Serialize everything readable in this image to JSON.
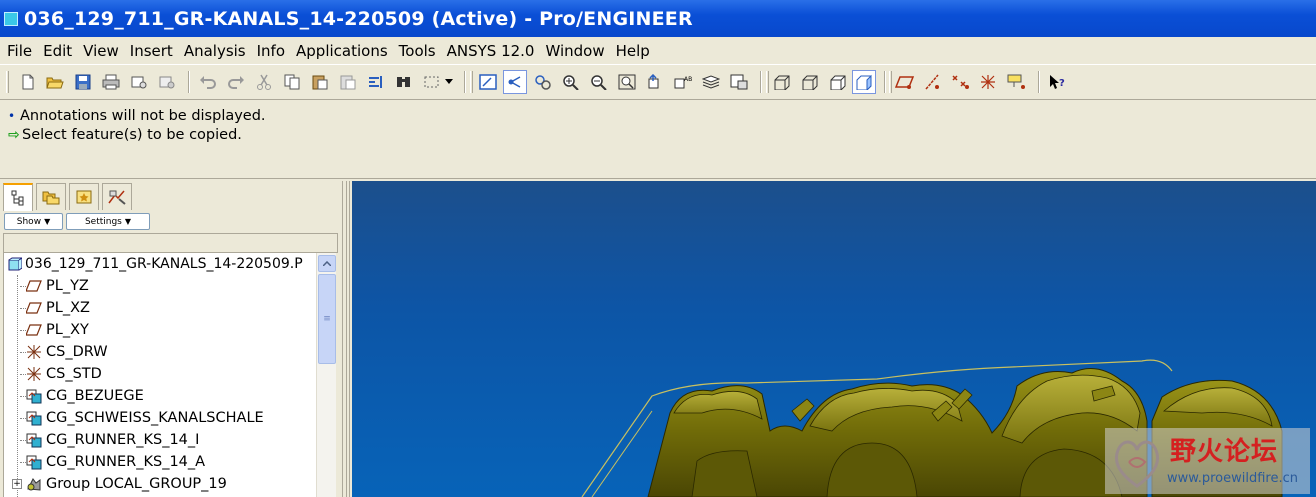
{
  "window": {
    "title": "036_129_711_GR-KANALS_14-220509 (Active) - Pro/ENGINEER"
  },
  "menu": {
    "items": [
      "File",
      "Edit",
      "View",
      "Insert",
      "Analysis",
      "Info",
      "Applications",
      "Tools",
      "ANSYS 12.0",
      "Window",
      "Help"
    ]
  },
  "toolbar": {
    "buttons": [
      "new-file",
      "open-file",
      "save",
      "print",
      "email",
      "email-link",
      "undo",
      "redo",
      "cut",
      "copy",
      "paste",
      "paste-special",
      "regenerate",
      "find",
      "select-box",
      "repaint",
      "spin-center",
      "orient",
      "zoom-in",
      "zoom-out",
      "refit",
      "reorient",
      "saved-views",
      "layers",
      "view-manager",
      "wireframe",
      "hidden-line",
      "no-hidden",
      "shading",
      "datum-planes",
      "datum-axes",
      "datum-points",
      "coordinate-systems",
      "annotations",
      "context-help"
    ]
  },
  "messages": [
    {
      "type": "info",
      "text": "Annotations will not be displayed."
    },
    {
      "type": "prompt",
      "text": "Select feature(s) to be copied."
    }
  ],
  "navigator": {
    "tabs": [
      "model-tree",
      "folder-browser",
      "favorites",
      "connections"
    ],
    "show_label": "Show",
    "settings_label": "Settings",
    "tree": {
      "root": "036_129_711_GR-KANALS_14-220509.P",
      "items": [
        {
          "label": "PL_YZ",
          "icon": "datum-plane-icon"
        },
        {
          "label": "PL_XZ",
          "icon": "datum-plane-icon"
        },
        {
          "label": "PL_XY",
          "icon": "datum-plane-icon"
        },
        {
          "label": "CS_DRW",
          "icon": "coordinate-system-icon"
        },
        {
          "label": "CS_STD",
          "icon": "coordinate-system-icon"
        },
        {
          "label": "CG_BEZUEGE",
          "icon": "copy-geometry-icon"
        },
        {
          "label": "CG_SCHWEISS_KANALSCHALE",
          "icon": "copy-geometry-icon"
        },
        {
          "label": "CG_RUNNER_KS_14_I",
          "icon": "copy-geometry-icon"
        },
        {
          "label": "CG_RUNNER_KS_14_A",
          "icon": "copy-geometry-icon"
        },
        {
          "label": "Group LOCAL_GROUP_19",
          "icon": "group-icon"
        }
      ]
    }
  },
  "watermark": {
    "chinese": "野火论坛",
    "url": "www.proewildfire.cn"
  },
  "colors": {
    "title_bar": "#0a4fd6",
    "viewport": "#0d55a6",
    "model": "#7a7a10"
  }
}
